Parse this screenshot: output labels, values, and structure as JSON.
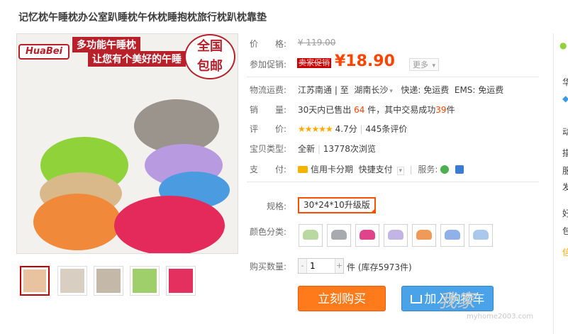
{
  "product": {
    "title": "记忆枕午睡枕办公室趴睡枕午休枕睡抱枕旅行枕趴枕靠垫"
  },
  "main_image": {
    "brand": "HuaBei",
    "slogan_line1": "多功能午睡枕",
    "slogan_line2": "让您有个美好的午睡",
    "badge_line1": "全国",
    "badge_line2": "包邮",
    "pillow_colors": [
      "#8fd23a",
      "#f08a3a",
      "#e42a5a",
      "#9a948c",
      "#b79ae0",
      "#4a9be0",
      "#d9b98a"
    ]
  },
  "thumbnails": [
    {
      "label": "thumb-1",
      "color": "#e9c3a0"
    },
    {
      "label": "thumb-2",
      "color": "#d8cfc2"
    },
    {
      "label": "thumb-3",
      "color": "#c4b8a8"
    },
    {
      "label": "thumb-4",
      "color": "#9fcf6a"
    },
    {
      "label": "thumb-5",
      "color": "#e3305e"
    }
  ],
  "price": {
    "label": "价　　格:",
    "original": "¥ 119.00"
  },
  "promo": {
    "label": "参加促销:",
    "tag": "卖家促销",
    "price": "¥18.90",
    "more": "更多"
  },
  "shipping": {
    "label": "物流运费:",
    "from": "江苏南通",
    "separator": "|",
    "to_prefix": "至",
    "to": "湖南长沙",
    "express": "快递: 免运费",
    "ems": "EMS: 免运费"
  },
  "sales": {
    "label": "销　　量:",
    "prefix": "30天内已售出",
    "count": "64",
    "middle": "件，其中交易成功",
    "success": "39",
    "suffix": "件"
  },
  "rating": {
    "label": "评　　价:",
    "stars": "★★★★★",
    "score": "4.7分",
    "separator": "|",
    "reviews": "445条评价"
  },
  "item_type": {
    "label": "宝贝类型:",
    "value": "全新",
    "separator": "|",
    "views": "13778次浏览"
  },
  "payment": {
    "label": "支　　付:",
    "credit": "信用卡分期",
    "quick": "快捷支付",
    "service_label": "服务:"
  },
  "sku": {
    "spec_label": "规格:",
    "spec_value": "30*24*10升级版",
    "color_label": "颜色分类:",
    "swatches": [
      "#b9d9a0",
      "#a9a9b0",
      "#e0438a",
      "#c3b4e6",
      "#f09a5a",
      "#8fb0e8",
      "#a9c8ec"
    ]
  },
  "quantity": {
    "label": "购买数量:",
    "value": "1",
    "minus": "-",
    "plus": "+",
    "stock": "件 (库存5973件)"
  },
  "buttons": {
    "buy": "立刻购买",
    "cart": "加入购物车"
  },
  "right_panel": {
    "chars": [
      "华",
      "动",
      "描",
      "服",
      "发",
      "好",
      "包",
      "信"
    ]
  },
  "watermark": {
    "main": "我家",
    "url": "myhome2003.com"
  },
  "colors": {
    "accent_orange": "#ff4400",
    "buy_button": "#ff7a1a",
    "cart_button": "#4aa3e8",
    "promo_tag": "#c40000"
  }
}
